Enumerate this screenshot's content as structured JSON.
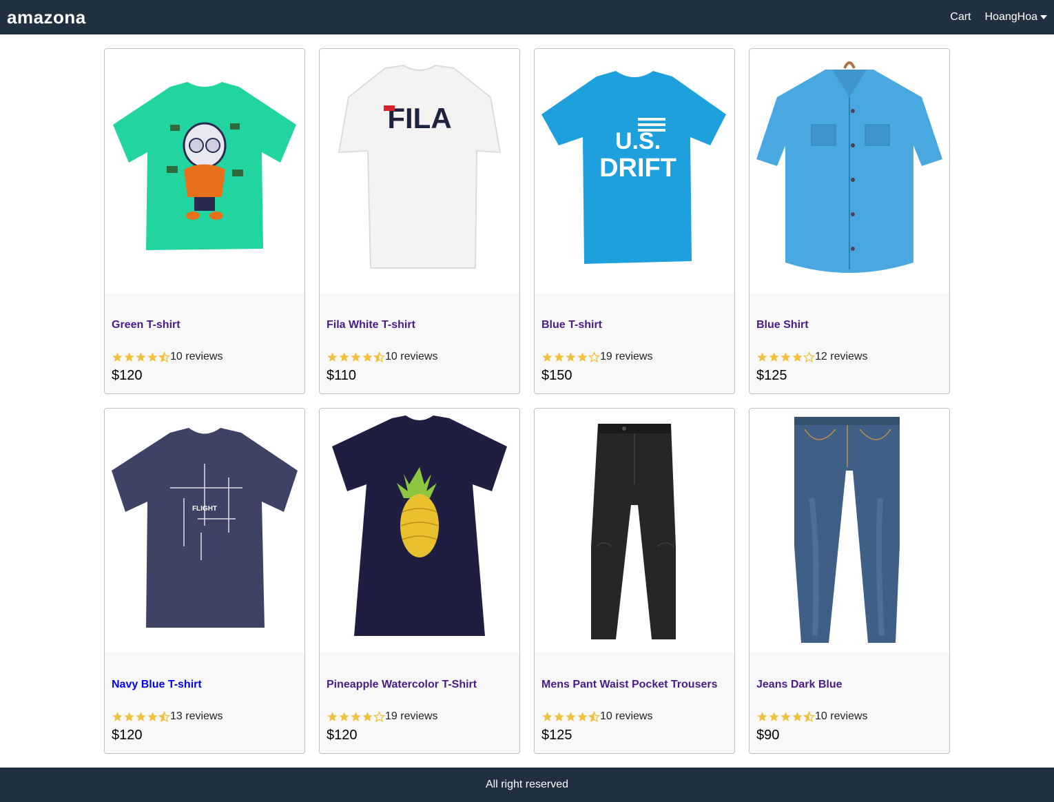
{
  "header": {
    "brand": "amazona",
    "cart_label": "Cart",
    "user_name": "HoangHoa"
  },
  "colors": {
    "header_bg": "#203040",
    "star": "#f0c040",
    "link": "#4b1a8a"
  },
  "products": [
    {
      "name": "Green T-shirt",
      "rating": 4.5,
      "reviews_text": "10 reviews",
      "price": "$120",
      "image": "green-tshirt"
    },
    {
      "name": "Fila White T-shirt",
      "rating": 4.5,
      "reviews_text": "10 reviews",
      "price": "$110",
      "image": "fila-white-tshirt"
    },
    {
      "name": "Blue T-shirt",
      "rating": 4,
      "reviews_text": "19 reviews",
      "price": "$150",
      "image": "blue-tshirt"
    },
    {
      "name": "Blue Shirt",
      "rating": 4,
      "reviews_text": "12 reviews",
      "price": "$125",
      "image": "blue-shirt"
    },
    {
      "name": "Navy Blue T-shirt",
      "rating": 4.5,
      "reviews_text": "13 reviews",
      "price": "$120",
      "image": "navy-tshirt"
    },
    {
      "name": "Pineapple Watercolor T-Shirt",
      "rating": 4,
      "reviews_text": "19 reviews",
      "price": "$120",
      "image": "pineapple-tshirt"
    },
    {
      "name": "Mens Pant Waist Pocket Trousers",
      "rating": 4.5,
      "reviews_text": "10 reviews",
      "price": "$125",
      "image": "black-trousers"
    },
    {
      "name": "Jeans Dark Blue",
      "rating": 4.5,
      "reviews_text": "10 reviews",
      "price": "$90",
      "image": "blue-jeans"
    }
  ],
  "footer": {
    "text": "All right reserved"
  }
}
